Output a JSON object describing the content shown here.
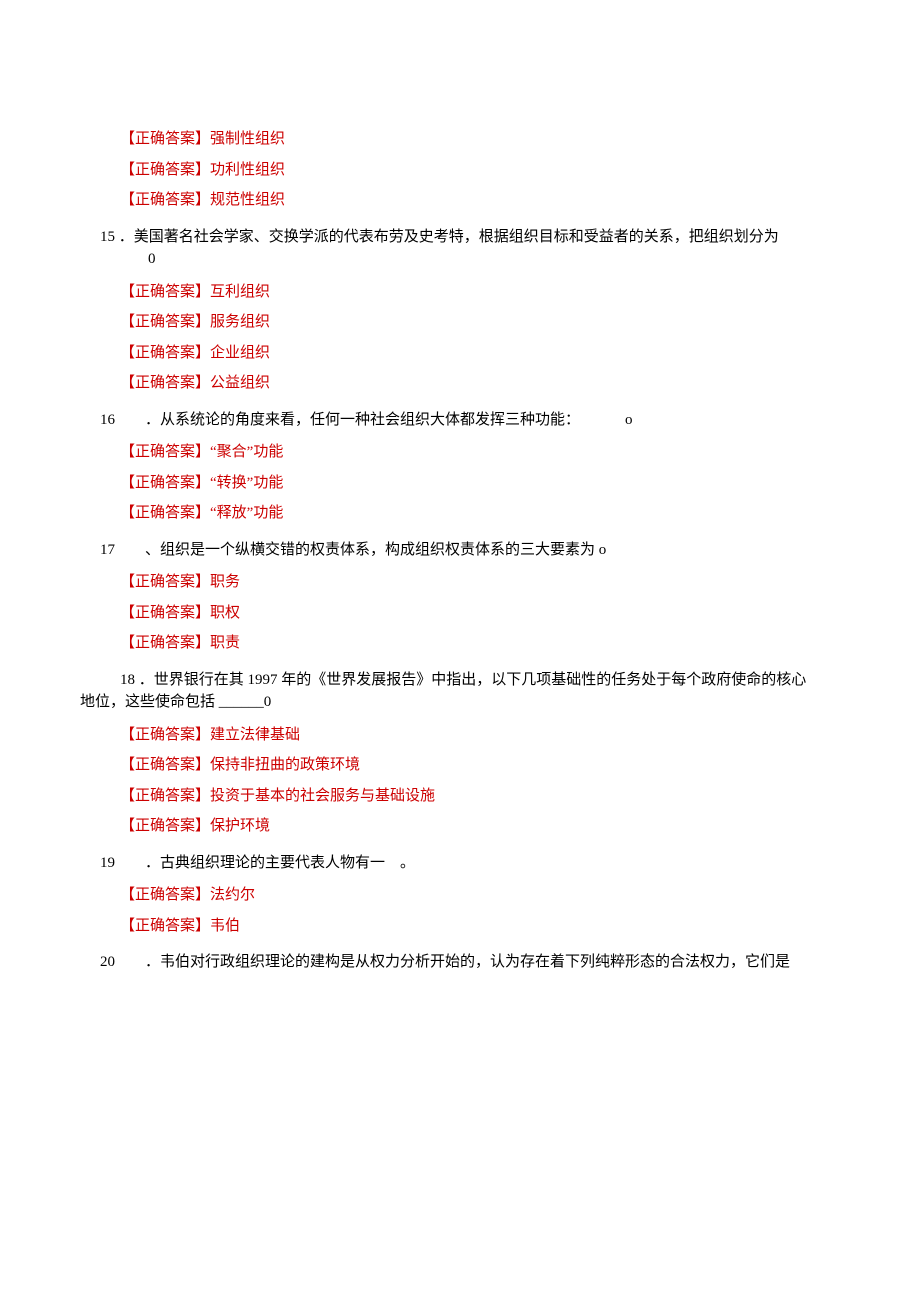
{
  "answer_label": "【正确答案】",
  "pre_answers": [
    "强制性组织",
    "功利性组织",
    "规范性组织"
  ],
  "questions": [
    {
      "num": "15",
      "text_main": "．美国著名社会学家、交换学派的代表布劳及史考特，根据组织目标和受益者的关系，把组织划分为",
      "text_sub": "0",
      "answers": [
        "互利组织",
        "服务组织",
        "企业组织",
        "公益组织"
      ]
    },
    {
      "num": "16",
      "text": "．从系统论的角度来看，任何一种社会组织大体都发挥三种功能：   o",
      "answers": [
        "“聚合”功能",
        "“转换”功能",
        "“释放”功能"
      ]
    },
    {
      "num": "17",
      "text": "、组织是一个纵横交错的权责体系，构成组织权责体系的三大要素为 o",
      "answers": [
        "职务",
        "职权",
        "职责"
      ]
    },
    {
      "num": "18",
      "text_line1": "．世界银行在其 1997 年的《世界发展报告》中指出，以下几项基础性的任务处于每个政府使命的核心",
      "text_line2": "地位，这些使命包括 ______0",
      "answers": [
        "建立法律基础",
        "保持非扭曲的政策环境",
        "投资于基本的社会服务与基础设施",
        "保护环境"
      ]
    },
    {
      "num": "19",
      "text": "．古典组织理论的主要代表人物有一 。",
      "answers": [
        "法约尔",
        "韦伯"
      ]
    },
    {
      "num": "20",
      "text": "．韦伯对行政组织理论的建构是从权力分析开始的，认为存在着下列纯粹形态的合法权力，它们是",
      "answers": []
    }
  ]
}
